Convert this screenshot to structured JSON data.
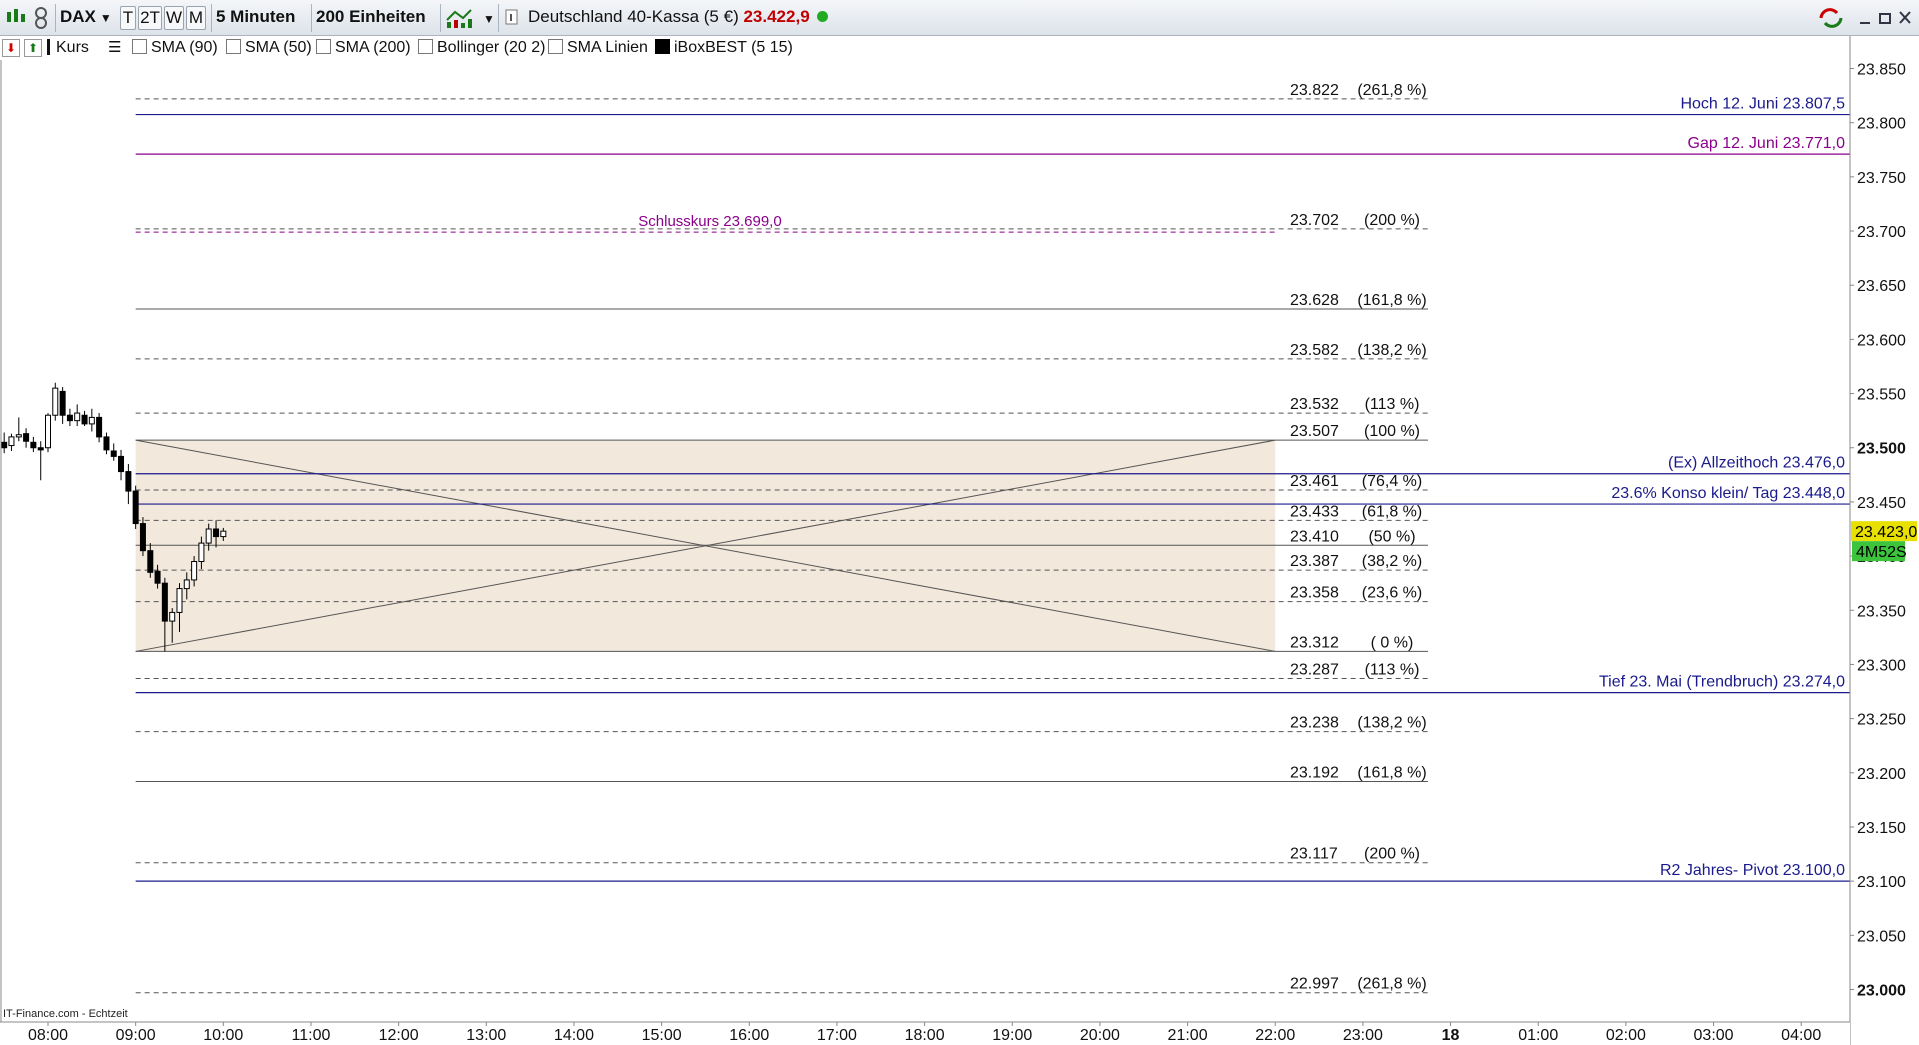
{
  "toolbar": {
    "symbol": "DAX",
    "periods": [
      "T",
      "2T",
      "W",
      "M"
    ],
    "interval": "5 Minuten",
    "units": "200 Einheiten",
    "instrument": "Deutschland 40-Kassa (5 €)",
    "last_price": "23.422,9",
    "status_color": "#22aa22",
    "price_color": "#c00000"
  },
  "indicators": {
    "kurs": "Kurs",
    "sma90": "SMA (90)",
    "sma50": "SMA (50)",
    "sma200": "SMA (200)",
    "bollinger": "Bollinger (20 2)",
    "sma_linien": "SMA Linien",
    "iboxbest": "iBoxBEST (5 15)"
  },
  "watermark": "IT-Finance.com - Echtzeit",
  "price_marker": {
    "label": "23.423,0",
    "value": 23423,
    "color": "#e8e000"
  },
  "countdown": {
    "label": "4M52S",
    "color": "#3cc43c"
  },
  "chart_data": {
    "type": "candlestick",
    "ylim": [
      22970,
      23880
    ],
    "y_ticks": [
      {
        "value": 23850,
        "label": "23.850",
        "bold": false
      },
      {
        "value": 23800,
        "label": "23.800",
        "bold": false
      },
      {
        "value": 23750,
        "label": "23.750",
        "bold": false
      },
      {
        "value": 23700,
        "label": "23.700",
        "bold": false
      },
      {
        "value": 23650,
        "label": "23.650",
        "bold": false
      },
      {
        "value": 23600,
        "label": "23.600",
        "bold": false
      },
      {
        "value": 23550,
        "label": "23.550",
        "bold": false
      },
      {
        "value": 23500,
        "label": "23.500",
        "bold": true
      },
      {
        "value": 23450,
        "label": "23.450",
        "bold": false
      },
      {
        "value": 23400,
        "label": "23.400",
        "bold": false
      },
      {
        "value": 23350,
        "label": "23.350",
        "bold": false
      },
      {
        "value": 23300,
        "label": "23.300",
        "bold": false
      },
      {
        "value": 23250,
        "label": "23.250",
        "bold": false
      },
      {
        "value": 23200,
        "label": "23.200",
        "bold": false
      },
      {
        "value": 23150,
        "label": "23.150",
        "bold": false
      },
      {
        "value": 23100,
        "label": "23.100",
        "bold": false
      },
      {
        "value": 23050,
        "label": "23.050",
        "bold": false
      },
      {
        "value": 23000,
        "label": "23.000",
        "bold": true
      }
    ],
    "x_hours_start": 7.5,
    "x_hours_end": 29.0,
    "x_ticks": [
      {
        "h": 8,
        "label": "08:00",
        "bold": false
      },
      {
        "h": 9,
        "label": "09:00",
        "bold": false
      },
      {
        "h": 10,
        "label": "10:00",
        "bold": false
      },
      {
        "h": 11,
        "label": "11:00",
        "bold": false
      },
      {
        "h": 12,
        "label": "12:00",
        "bold": false
      },
      {
        "h": 13,
        "label": "13:00",
        "bold": false
      },
      {
        "h": 14,
        "label": "14:00",
        "bold": false
      },
      {
        "h": 15,
        "label": "15:00",
        "bold": false
      },
      {
        "h": 16,
        "label": "16:00",
        "bold": false
      },
      {
        "h": 17,
        "label": "17:00",
        "bold": false
      },
      {
        "h": 18,
        "label": "18:00",
        "bold": false
      },
      {
        "h": 19,
        "label": "19:00",
        "bold": false
      },
      {
        "h": 20,
        "label": "20:00",
        "bold": false
      },
      {
        "h": 21,
        "label": "21:00",
        "bold": false
      },
      {
        "h": 22,
        "label": "22:00",
        "bold": false
      },
      {
        "h": 23,
        "label": "23:00",
        "bold": false
      },
      {
        "h": 24,
        "label": "18",
        "bold": true
      },
      {
        "h": 25,
        "label": "01:00",
        "bold": false
      },
      {
        "h": 26,
        "label": "02:00",
        "bold": false
      },
      {
        "h": 27,
        "label": "03:00",
        "bold": false
      },
      {
        "h": 28,
        "label": "04:00",
        "bold": false
      }
    ],
    "candles": [
      {
        "t": 7.5,
        "o": 23505,
        "h": 23514,
        "l": 23495,
        "c": 23500
      },
      {
        "t": 7.583,
        "o": 23502,
        "h": 23513,
        "l": 23497,
        "c": 23510
      },
      {
        "t": 7.667,
        "o": 23510,
        "h": 23528,
        "l": 23506,
        "c": 23512
      },
      {
        "t": 7.75,
        "o": 23513,
        "h": 23518,
        "l": 23500,
        "c": 23506
      },
      {
        "t": 7.833,
        "o": 23505,
        "h": 23510,
        "l": 23496,
        "c": 23500
      },
      {
        "t": 7.917,
        "o": 23500,
        "h": 23506,
        "l": 23470,
        "c": 23498
      },
      {
        "t": 8.0,
        "o": 23500,
        "h": 23532,
        "l": 23496,
        "c": 23530
      },
      {
        "t": 8.083,
        "o": 23530,
        "h": 23560,
        "l": 23525,
        "c": 23555
      },
      {
        "t": 8.167,
        "o": 23552,
        "h": 23556,
        "l": 23522,
        "c": 23530
      },
      {
        "t": 8.25,
        "o": 23530,
        "h": 23536,
        "l": 23520,
        "c": 23525
      },
      {
        "t": 8.333,
        "o": 23525,
        "h": 23540,
        "l": 23520,
        "c": 23532
      },
      {
        "t": 8.417,
        "o": 23530,
        "h": 23534,
        "l": 23520,
        "c": 23522
      },
      {
        "t": 8.5,
        "o": 23522,
        "h": 23536,
        "l": 23515,
        "c": 23528
      },
      {
        "t": 8.583,
        "o": 23528,
        "h": 23532,
        "l": 23505,
        "c": 23510
      },
      {
        "t": 8.667,
        "o": 23510,
        "h": 23514,
        "l": 23494,
        "c": 23498
      },
      {
        "t": 8.75,
        "o": 23497,
        "h": 23504,
        "l": 23488,
        "c": 23492
      },
      {
        "t": 8.833,
        "o": 23492,
        "h": 23498,
        "l": 23470,
        "c": 23478
      },
      {
        "t": 8.917,
        "o": 23478,
        "h": 23485,
        "l": 23448,
        "c": 23460
      },
      {
        "t": 9.0,
        "o": 23460,
        "h": 23465,
        "l": 23425,
        "c": 23430
      },
      {
        "t": 9.083,
        "o": 23430,
        "h": 23436,
        "l": 23400,
        "c": 23405
      },
      {
        "t": 9.167,
        "o": 23405,
        "h": 23412,
        "l": 23380,
        "c": 23385
      },
      {
        "t": 9.25,
        "o": 23386,
        "h": 23392,
        "l": 23370,
        "c": 23375
      },
      {
        "t": 9.333,
        "o": 23375,
        "h": 23380,
        "l": 23312,
        "c": 23340
      },
      {
        "t": 9.417,
        "o": 23340,
        "h": 23352,
        "l": 23320,
        "c": 23348
      },
      {
        "t": 9.5,
        "o": 23348,
        "h": 23375,
        "l": 23330,
        "c": 23370
      },
      {
        "t": 9.583,
        "o": 23370,
        "h": 23385,
        "l": 23360,
        "c": 23378
      },
      {
        "t": 9.667,
        "o": 23378,
        "h": 23400,
        "l": 23372,
        "c": 23395
      },
      {
        "t": 9.75,
        "o": 23395,
        "h": 23418,
        "l": 23388,
        "c": 23412
      },
      {
        "t": 9.833,
        "o": 23412,
        "h": 23430,
        "l": 23405,
        "c": 23425
      },
      {
        "t": 9.917,
        "o": 23425,
        "h": 23433,
        "l": 23408,
        "c": 23418
      },
      {
        "t": 10.0,
        "o": 23418,
        "h": 23426,
        "l": 23414,
        "c": 23423
      }
    ],
    "fib_box": {
      "t_start": 9.0,
      "t_end": 22.0,
      "top": 23507,
      "bottom": 23312,
      "fill": "#f2e8dc"
    },
    "fib_levels": [
      {
        "value": 23822,
        "label": "23.822",
        "pct": "(261,8 %)",
        "style": "dashed"
      },
      {
        "value": 23702,
        "label": "23.702",
        "pct": "(200 %)",
        "style": "dashed"
      },
      {
        "value": 23628,
        "label": "23.628",
        "pct": "(161,8 %)",
        "style": "solid"
      },
      {
        "value": 23582,
        "label": "23.582",
        "pct": "(138,2 %)",
        "style": "dashed"
      },
      {
        "value": 23532,
        "label": "23.532",
        "pct": "(113 %)",
        "style": "dashed"
      },
      {
        "value": 23507,
        "label": "23.507",
        "pct": "(100 %)",
        "style": "solid"
      },
      {
        "value": 23461,
        "label": "23.461",
        "pct": "(76,4 %)",
        "style": "dashed"
      },
      {
        "value": 23433,
        "label": "23.433",
        "pct": "(61,8 %)",
        "style": "dashed"
      },
      {
        "value": 23410,
        "label": "23.410",
        "pct": "(50 %)",
        "style": "solid"
      },
      {
        "value": 23387,
        "label": "23.387",
        "pct": "(38,2 %)",
        "style": "dashed"
      },
      {
        "value": 23358,
        "label": "23.358",
        "pct": "(23,6 %)",
        "style": "dashed"
      },
      {
        "value": 23312,
        "label": "23.312",
        "pct": "( 0 %)",
        "style": "solid"
      },
      {
        "value": 23287,
        "label": "23.287",
        "pct": "(113 %)",
        "style": "dashed"
      },
      {
        "value": 23238,
        "label": "23.238",
        "pct": "(138,2 %)",
        "style": "dashed"
      },
      {
        "value": 23192,
        "label": "23.192",
        "pct": "(161,8 %)",
        "style": "solid"
      },
      {
        "value": 23117,
        "label": "23.117",
        "pct": "(200 %)",
        "style": "dashed"
      },
      {
        "value": 22997,
        "label": "22.997",
        "pct": "(261,8 %)",
        "style": "dashed"
      }
    ],
    "hlines": [
      {
        "value": 23807.5,
        "label": "Hoch 12. Juni 23.807,5",
        "color": "#1a1a8c",
        "style": "solid"
      },
      {
        "value": 23771.0,
        "label": "Gap 12. Juni 23.771,0",
        "color": "#8b008b",
        "style": "solid"
      },
      {
        "value": 23476.0,
        "label": "(Ex) Allzeithoch  23.476,0",
        "color": "#1a1a8c",
        "style": "solid"
      },
      {
        "value": 23448.0,
        "label": "23.6% Konso klein/ Tag 23.448,0",
        "color": "#1a1a8c",
        "style": "solid"
      },
      {
        "value": 23274.0,
        "label": "Tief 23. Mai (Trendbruch) 23.274,0",
        "color": "#1a1a8c",
        "style": "solid"
      },
      {
        "value": 23100.0,
        "label": "R2 Jahres- Pivot 23.100,0",
        "color": "#1a1a8c",
        "style": "solid"
      }
    ],
    "schlusskurs": {
      "value": 23699.0,
      "label": "Schlusskurs 23.699,0",
      "color": "#8b008b"
    }
  }
}
